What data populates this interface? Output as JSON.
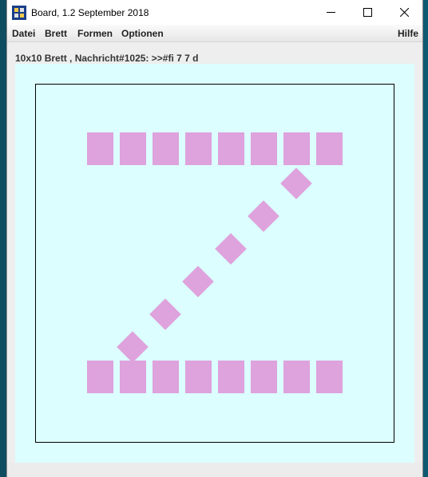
{
  "window": {
    "title": "Board, 1.2 September 2018",
    "icon": "board-app-icon"
  },
  "controls": {
    "minimize_icon": "minimize-icon",
    "maximize_icon": "maximize-icon",
    "close_icon": "close-icon"
  },
  "menu": {
    "datei": "Datei",
    "brett": "Brett",
    "formen": "Formen",
    "optionen": "Optionen",
    "hilfe": "Hilfe"
  },
  "status": "10x10 Brett , Nachricht#1025: >>#fi 7 7 d",
  "board": {
    "size": "10x10",
    "background_color": "#dcfefe",
    "shape_color": "#dea2dc",
    "top_row_squares": 8,
    "bottom_row_squares": 8,
    "diagonal_diamonds": 6,
    "letter": "Z"
  }
}
